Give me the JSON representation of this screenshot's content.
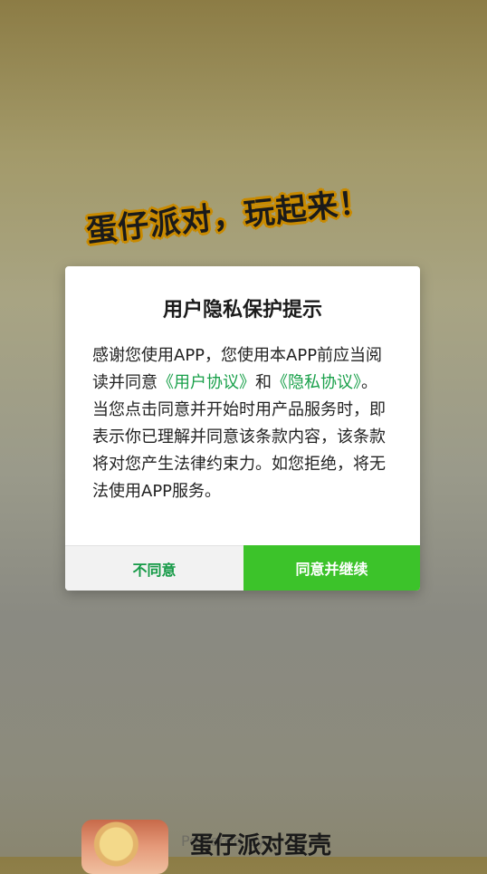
{
  "splash": {
    "slogan": "蛋仔派对，玩起来！",
    "app_name": "蛋仔派对蛋壳",
    "powered_text": "Powered by"
  },
  "dialog": {
    "title": "用户隐私保护提示",
    "body_part1": "感谢您使用APP，您使用本APP前应当阅读并同意",
    "link_user_agreement": "《用户协议》",
    "body_and": "和",
    "link_privacy": "《隐私协议》",
    "body_part2": "。当您点击同意并开始时用产品服务时，即表示你已理解并同意该条款内容，该条款将对您产生法律约束力。如您拒绝，将无法使用APP服务。",
    "disagree_label": "不同意",
    "agree_label": "同意并继续"
  },
  "colors": {
    "accent_green": "#3cc32a",
    "link_green": "#19a04a"
  }
}
